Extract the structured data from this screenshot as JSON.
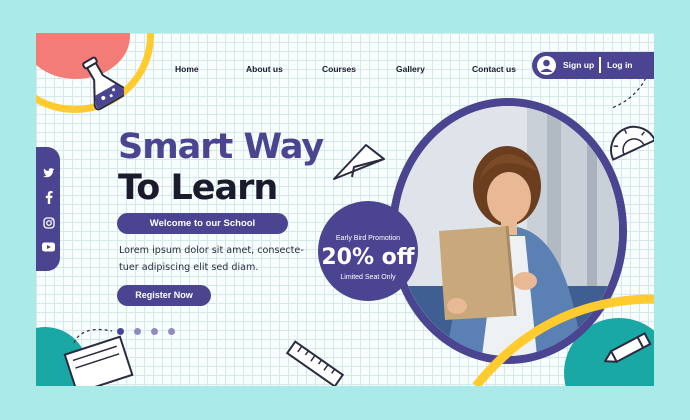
{
  "nav": {
    "items": [
      {
        "label": "Home"
      },
      {
        "label": "About us"
      },
      {
        "label": "Courses"
      },
      {
        "label": "Gallery"
      },
      {
        "label": "Contact us"
      }
    ],
    "auth": {
      "signup": "Sign up",
      "login": "Log in"
    }
  },
  "social": [
    "twitter-icon",
    "facebook-icon",
    "instagram-icon",
    "youtube-icon"
  ],
  "hero": {
    "title_line1": "Smart Way",
    "title_line2": "To Learn",
    "welcome": "Welcome to our School",
    "description": "Lorem ipsum dolor sit amet, consecte-tuer adipiscing elit sed diam.",
    "cta": "Register Now"
  },
  "promo": {
    "line1": "Early Bird Promotion",
    "headline": "20% off",
    "line2": "Limited Seat Only"
  },
  "carousel": {
    "count": 4,
    "active": 0
  },
  "colors": {
    "primary": "#4b4591",
    "accent_yellow": "#ffcb2e",
    "accent_red": "#f47c76",
    "accent_teal": "#1aa8a5",
    "background": "#aaeae8"
  }
}
